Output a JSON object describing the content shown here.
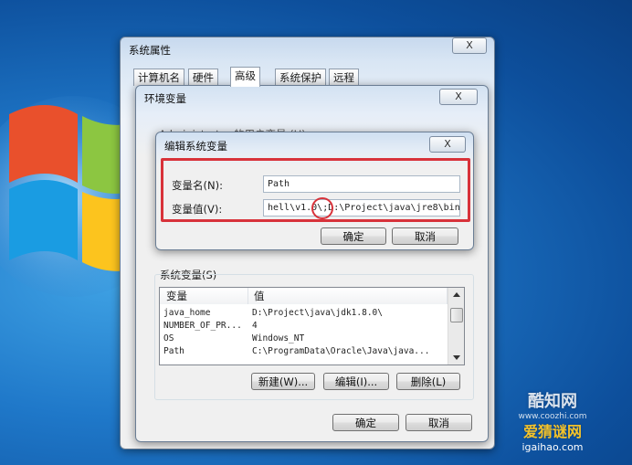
{
  "desktop": {
    "watermark_line1": "酷知网",
    "watermark_line2": "www.coozhi.com",
    "watermark_line3": "爱猜谜网",
    "watermark_line4": "igaihao.com"
  },
  "sysprop": {
    "title": "系统属性",
    "close_label": "X",
    "tabs": [
      {
        "label": "计算机名"
      },
      {
        "label": "硬件"
      },
      {
        "label": "高级"
      },
      {
        "label": "系统保护"
      },
      {
        "label": "远程"
      }
    ]
  },
  "envvar": {
    "title": "环境变量",
    "close_label": "X",
    "user_vars_label": "Administrator 的用户变量 (U)",
    "system_vars_label": "系统变量(S)",
    "columns": {
      "name": "变量",
      "value": "值"
    },
    "rows": [
      {
        "name": "java_home",
        "value": "D:\\Project\\java\\jdk1.8.0\\"
      },
      {
        "name": "NUMBER_OF_PR...",
        "value": "4"
      },
      {
        "name": "OS",
        "value": "Windows_NT"
      },
      {
        "name": "Path",
        "value": "C:\\ProgramData\\Oracle\\Java\\java..."
      }
    ],
    "new_label": "新建(W)...",
    "edit_label": "编辑(I)...",
    "delete_label": "删除(L)",
    "ok_label": "确定",
    "cancel_label": "取消"
  },
  "editvar": {
    "title": "编辑系统变量",
    "close_label": "X",
    "name_label": "变量名(N):",
    "value_label": "变量值(V):",
    "name_value": "Path",
    "value_value": "hell\\v1.0\\;D:\\Project\\java\\jre8\\bin",
    "ok_label": "确定",
    "cancel_label": "取消"
  },
  "colors": {
    "highlight": "#d8323a",
    "desktop": "#1f78c9"
  }
}
